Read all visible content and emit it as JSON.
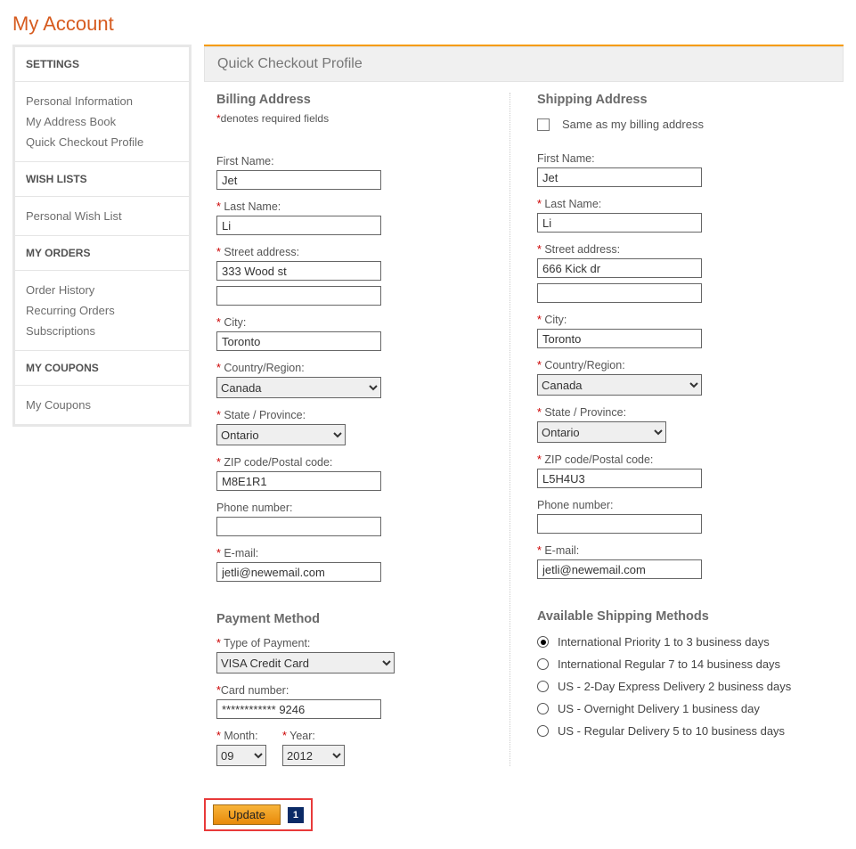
{
  "page_title": "My Account",
  "sidebar": {
    "sections": [
      {
        "header": "SETTINGS",
        "links": [
          "Personal Information",
          "My Address Book",
          "Quick Checkout Profile"
        ]
      },
      {
        "header": "WISH LISTS",
        "links": [
          "Personal Wish List"
        ]
      },
      {
        "header": "MY ORDERS",
        "links": [
          "Order History",
          "Recurring Orders",
          "Subscriptions"
        ]
      },
      {
        "header": "MY COUPONS",
        "links": [
          "My Coupons"
        ]
      }
    ]
  },
  "panel_header": "Quick Checkout Profile",
  "billing": {
    "heading": "Billing Address",
    "required_note_star": "*",
    "required_note": "denotes required fields",
    "labels": {
      "first": "First Name:",
      "last": "Last Name:",
      "street": "Street address:",
      "city": "City:",
      "country": "Country/Region:",
      "state": "State / Province:",
      "zip": "ZIP code/Postal code:",
      "phone": "Phone number:",
      "email": "E-mail:"
    },
    "values": {
      "first": "Jet",
      "last": "Li",
      "street1": "333 Wood st",
      "street2": "",
      "city": "Toronto",
      "country": "Canada",
      "state": "Ontario",
      "zip": "M8E1R1",
      "phone": "",
      "email": "jetli@newemail.com"
    }
  },
  "shipping": {
    "heading": "Shipping Address",
    "same_label": "Same as my billing address",
    "labels": {
      "first": "First Name:",
      "last": "Last Name:",
      "street": "Street address:",
      "city": "City:",
      "country": "Country/Region:",
      "state": "State / Province:",
      "zip": "ZIP code/Postal code:",
      "phone": "Phone number:",
      "email": "E-mail:"
    },
    "values": {
      "first": "Jet",
      "last": "Li",
      "street1": "666 Kick dr",
      "street2": "",
      "city": "Toronto",
      "country": "Canada",
      "state": "Ontario",
      "zip": "L5H4U3",
      "phone": "",
      "email": "jetli@newemail.com"
    }
  },
  "payment": {
    "heading": "Payment Method",
    "type_label": "Type of Payment:",
    "type_value": "VISA Credit Card",
    "card_label": "Card number:",
    "card_value": "************ 9246",
    "month_label": "Month:",
    "month_value": "09",
    "year_label": "Year:",
    "year_value": "2012"
  },
  "shipping_methods": {
    "heading": "Available Shipping Methods",
    "options": [
      {
        "label": "International Priority 1 to 3 business days",
        "selected": true
      },
      {
        "label": "International Regular 7 to 14 business days",
        "selected": false
      },
      {
        "label": "US - 2-Day Express Delivery 2 business days",
        "selected": false
      },
      {
        "label": "US - Overnight Delivery 1 business day",
        "selected": false
      },
      {
        "label": "US - Regular Delivery 5 to 10 business days",
        "selected": false
      }
    ]
  },
  "footer": {
    "update": "Update",
    "badge": "1"
  }
}
